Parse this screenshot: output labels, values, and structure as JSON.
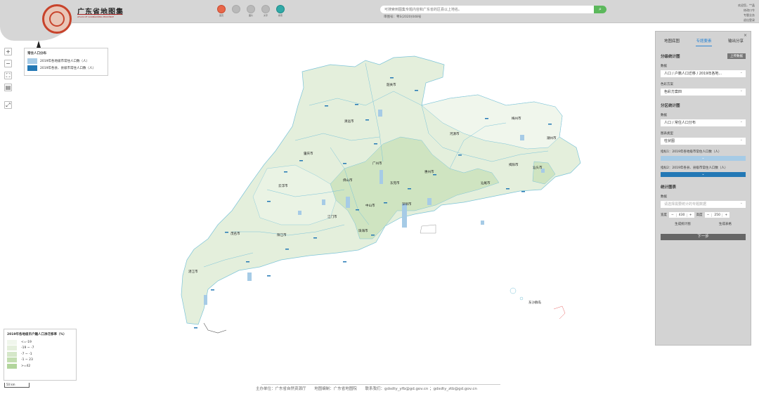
{
  "header": {
    "brand_title": "广东省地图集",
    "brand_subtitle": "ATLAS OF GUANGDONG PROVINCE",
    "nav_items": [
      {
        "label": "首页",
        "icon": "home-icon",
        "color": "#e8674a"
      },
      {
        "label": "",
        "icon": "grey-circle-icon",
        "color": "#b9b9b9"
      },
      {
        "label": "图片",
        "icon": "grey-circle-icon",
        "color": "#b9b9b9"
      },
      {
        "label": "文字",
        "icon": "grey-circle-icon",
        "color": "#b9b9b9"
      },
      {
        "label": "搜索",
        "icon": "globe-icon",
        "color": "#31a9a7"
      }
    ],
    "search_placeholder": "可搜索到图集专题内容和广东省的区县以上地名。",
    "review_number": "审图号：粤S(2020)048号",
    "user": {
      "welcome": "欢迎您，**晶",
      "links": [
        "修改口令",
        "专题业务",
        "退出登录"
      ]
    }
  },
  "map_controls": [
    "+",
    "−",
    "⛶",
    "▤",
    "⤢"
  ],
  "top_legend": {
    "title": "常住人口分布",
    "items": [
      {
        "label": "2019年各地级市常住人口数（人）",
        "color": "#a6cbe6"
      },
      {
        "label": "2019年各县、县级市常住人口数（人）",
        "color": "#2378b5"
      }
    ]
  },
  "bottom_legend": {
    "title": "2019年各地级市户籍人口净迁移率（%）",
    "items": [
      {
        "label": "<=-19",
        "color": "#f0f6ec"
      },
      {
        "label": "-19 ~ -7",
        "color": "#e4efdc"
      },
      {
        "label": "-7 ~ -1",
        "color": "#d5e7c9"
      },
      {
        "label": "-1 ~ 23",
        "color": "#c3deb1"
      },
      {
        "label": ">=42",
        "color": "#b2d59c"
      }
    ]
  },
  "scale_label": "50 km",
  "map_labels": [
    "韶关市",
    "清远市",
    "河源市",
    "梅州市",
    "潮州市",
    "肇庆市",
    "广州市",
    "惠州市",
    "揭阳市",
    "汕头市",
    "云浮市",
    "佛山市",
    "东莞市",
    "汕尾市",
    "深圳市",
    "江门市",
    "中山市",
    "珠海市",
    "阳江市",
    "茂名市",
    "湛江市",
    "东沙群岛"
  ],
  "footer": {
    "sponsor": "主办单位：广东省自然资源厅",
    "editor": "地图编制：广东省地图院",
    "contact": "联系我们：gdsdty_yfb@gd.gov.cn ；gdsdty_ztb@gd.gov.cn"
  },
  "panel": {
    "tabs": [
      "地图底图",
      "专题要素",
      "输出分享"
    ],
    "active_tab": 1,
    "close": "×",
    "section1": {
      "title": "分级统计图",
      "upload_label": "上传数据",
      "data_label": "数据",
      "data_value": "人口 / 户籍人口迁移 / 2019年各地...",
      "color_label": "色彩方案",
      "color_value": "色彩方案四"
    },
    "section2": {
      "title": "分区统计图",
      "data_label": "数据",
      "data_value": "人口 / 常住人口分布",
      "chart_type_label": "图表类型",
      "chart_type_value": "柱状图",
      "index1_label": "指标1：2019年各地级市常住人口数（人）",
      "index1_color": "#a6cbe6",
      "index2_label": "指标2：2019年各县、县级市常住人口数（人）",
      "index2_color": "#2378b5"
    },
    "section3": {
      "title": "统计图表",
      "data_label": "数据",
      "data_placeholder": "请选择需要统计的专题数据",
      "width_label": "宽度",
      "width_value": "430",
      "height_label": "高度",
      "height_value": "250",
      "gen_chart": "生成统计图",
      "gen_table": "生成表格"
    },
    "next": "下一步"
  }
}
